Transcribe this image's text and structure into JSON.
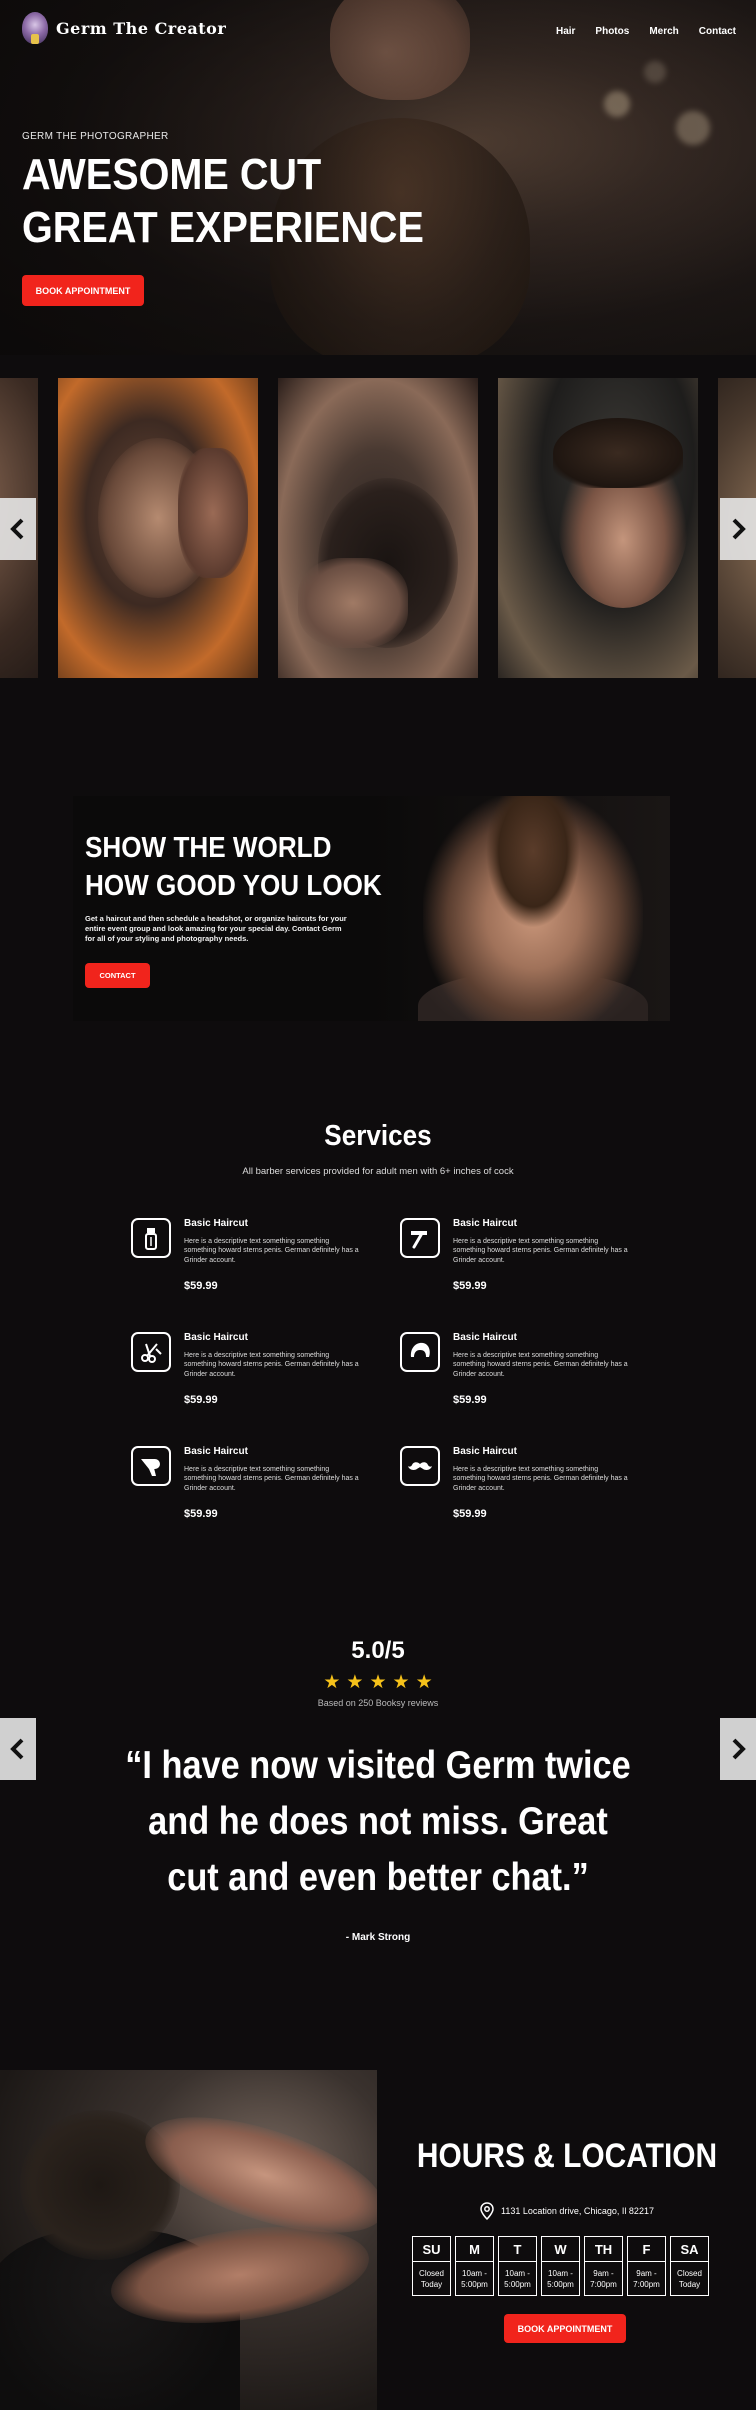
{
  "header": {
    "brand": "Germ The Creator",
    "nav": [
      "Hair",
      "Photos",
      "Merch",
      "Contact"
    ]
  },
  "hero": {
    "eyebrow": "GERM THE PHOTOGRAPHER",
    "title_line1": "AWESOME CUT",
    "title_line2": "GREAT EXPERIENCE",
    "cta": "BOOK APPOINTMENT"
  },
  "gallery": {
    "prev_icon": "chevron-left-icon",
    "next_icon": "chevron-right-icon"
  },
  "promo": {
    "title_line1": "SHOW THE WORLD",
    "title_line2": "HOW GOOD YOU LOOK",
    "text": "Get a haircut and then schedule a headshot, or organize haircuts for your entire event group and look amazing for your special day. Contact Germ for all of your styling and photography needs.",
    "cta": "CONTACT"
  },
  "services": {
    "title": "Services",
    "subtitle": "All barber services provided for adult men with 6+ inches of cock",
    "items": [
      {
        "name": "Basic Haircut",
        "desc": "Here is a descriptive text something something something howard sterns penis. German definitely has a Grinder account.",
        "price": "$59.99",
        "icon": "razor-icon"
      },
      {
        "name": "Basic Haircut",
        "desc": "Here is a descriptive text something something something howard sterns penis. German definitely has a Grinder account.",
        "price": "$59.99",
        "icon": "straight-razor-icon"
      },
      {
        "name": "Basic Haircut",
        "desc": "Here is a descriptive text something something something howard sterns penis. German definitely has a Grinder account.",
        "price": "$59.99",
        "icon": "scissors-comb-icon"
      },
      {
        "name": "Basic Haircut",
        "desc": "Here is a descriptive text something something something howard sterns penis. German definitely has a Grinder account.",
        "price": "$59.99",
        "icon": "hair-icon"
      },
      {
        "name": "Basic Haircut",
        "desc": "Here is a descriptive text something something something howard sterns penis. German definitely has a Grinder account.",
        "price": "$59.99",
        "icon": "hair-dryer-icon"
      },
      {
        "name": "Basic Haircut",
        "desc": "Here is a descriptive text something something something howard sterns penis. German definitely has a Grinder account.",
        "price": "$59.99",
        "icon": "mustache-icon"
      }
    ]
  },
  "reviews": {
    "rating": "5.0/5",
    "stars": 5,
    "based_on": "Based on 250 Booksy reviews",
    "quote": "“I have now visited Germ twice and he does not miss. Great cut and even better chat.”",
    "author": "- Mark Strong"
  },
  "hours": {
    "title": "HOURS & LOCATION",
    "address": "1131 Location drive, Chicago, Il 82217",
    "days": [
      {
        "day": "SU",
        "hours": "Closed\nToday"
      },
      {
        "day": "M",
        "hours": "10am -\n5:00pm"
      },
      {
        "day": "T",
        "hours": "10am -\n5:00pm"
      },
      {
        "day": "W",
        "hours": "10am -\n5:00pm"
      },
      {
        "day": "TH",
        "hours": "9am -\n7:00pm"
      },
      {
        "day": "F",
        "hours": "9am -\n7:00pm"
      },
      {
        "day": "SA",
        "hours": "Closed\nToday"
      }
    ],
    "cta": "BOOK APPOINTMENT"
  },
  "colors": {
    "background": "#0e0c0d",
    "accent": "#f1241c",
    "star": "#f6c21a",
    "text": "#ffffff"
  }
}
